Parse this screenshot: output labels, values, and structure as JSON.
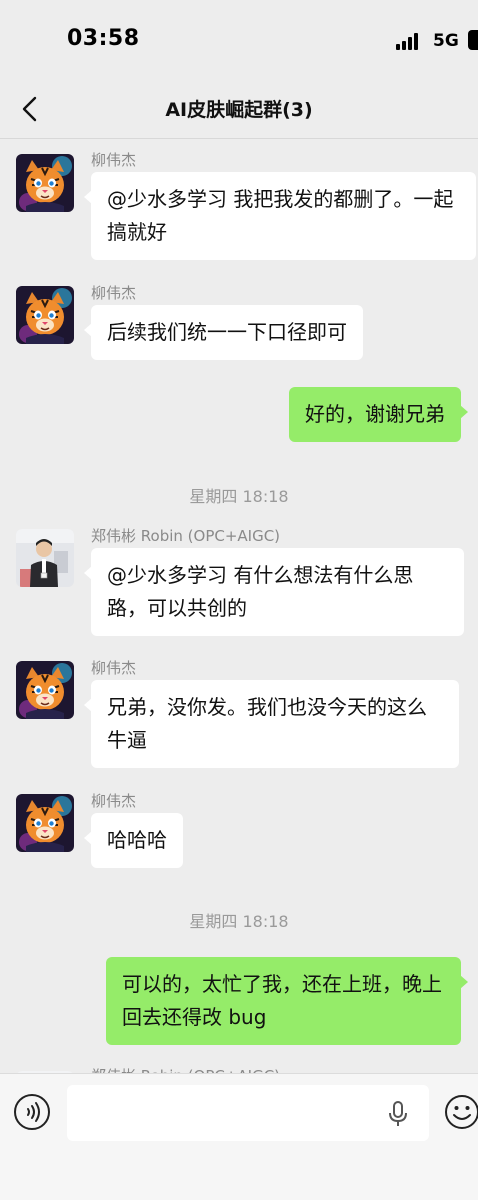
{
  "status_bar": {
    "time": "03:58",
    "network": "5G"
  },
  "header": {
    "title": "AI皮肤崛起群(3)"
  },
  "messages": [
    {
      "type": "incoming",
      "sender": "柳伟杰",
      "avatar": "tiger-avatar",
      "text": "@少水多学习 我把我发的都删了。一起搞就好"
    },
    {
      "type": "incoming",
      "sender": "柳伟杰",
      "avatar": "tiger-avatar",
      "text": "后续我们统一一下口径即可"
    },
    {
      "type": "outgoing",
      "text": "好的，谢谢兄弟"
    },
    {
      "type": "timestamp",
      "text": "星期四 18:18"
    },
    {
      "type": "incoming",
      "sender": "郑伟彬 Robin (OPC+AIGC)",
      "avatar": "photo-avatar",
      "text": "@少水多学习 有什么想法有什么思路，可以共创的"
    },
    {
      "type": "incoming",
      "sender": "柳伟杰",
      "avatar": "tiger-avatar",
      "text": "兄弟，没你发。我们也没今天的这么牛逼"
    },
    {
      "type": "incoming",
      "sender": "柳伟杰",
      "avatar": "tiger-avatar",
      "text": "哈哈哈"
    },
    {
      "type": "timestamp",
      "text": "星期四 18:18"
    },
    {
      "type": "outgoing",
      "text": "可以的，太忙了我，还在上班，晚上回去还得改 bug"
    },
    {
      "type": "incoming",
      "sender": "郑伟彬 Robin (OPC+AIGC)",
      "avatar": "photo-avatar",
      "text": ""
    }
  ],
  "input_bar": {
    "value": "",
    "placeholder": ""
  },
  "colors": {
    "background": "#ededed",
    "outgoing_bubble": "#95ec69",
    "incoming_bubble": "#ffffff"
  },
  "icons": {
    "back": "chevron-left-icon",
    "voice": "voice-icon",
    "mic": "microphone-icon",
    "emoji": "smiley-icon"
  }
}
